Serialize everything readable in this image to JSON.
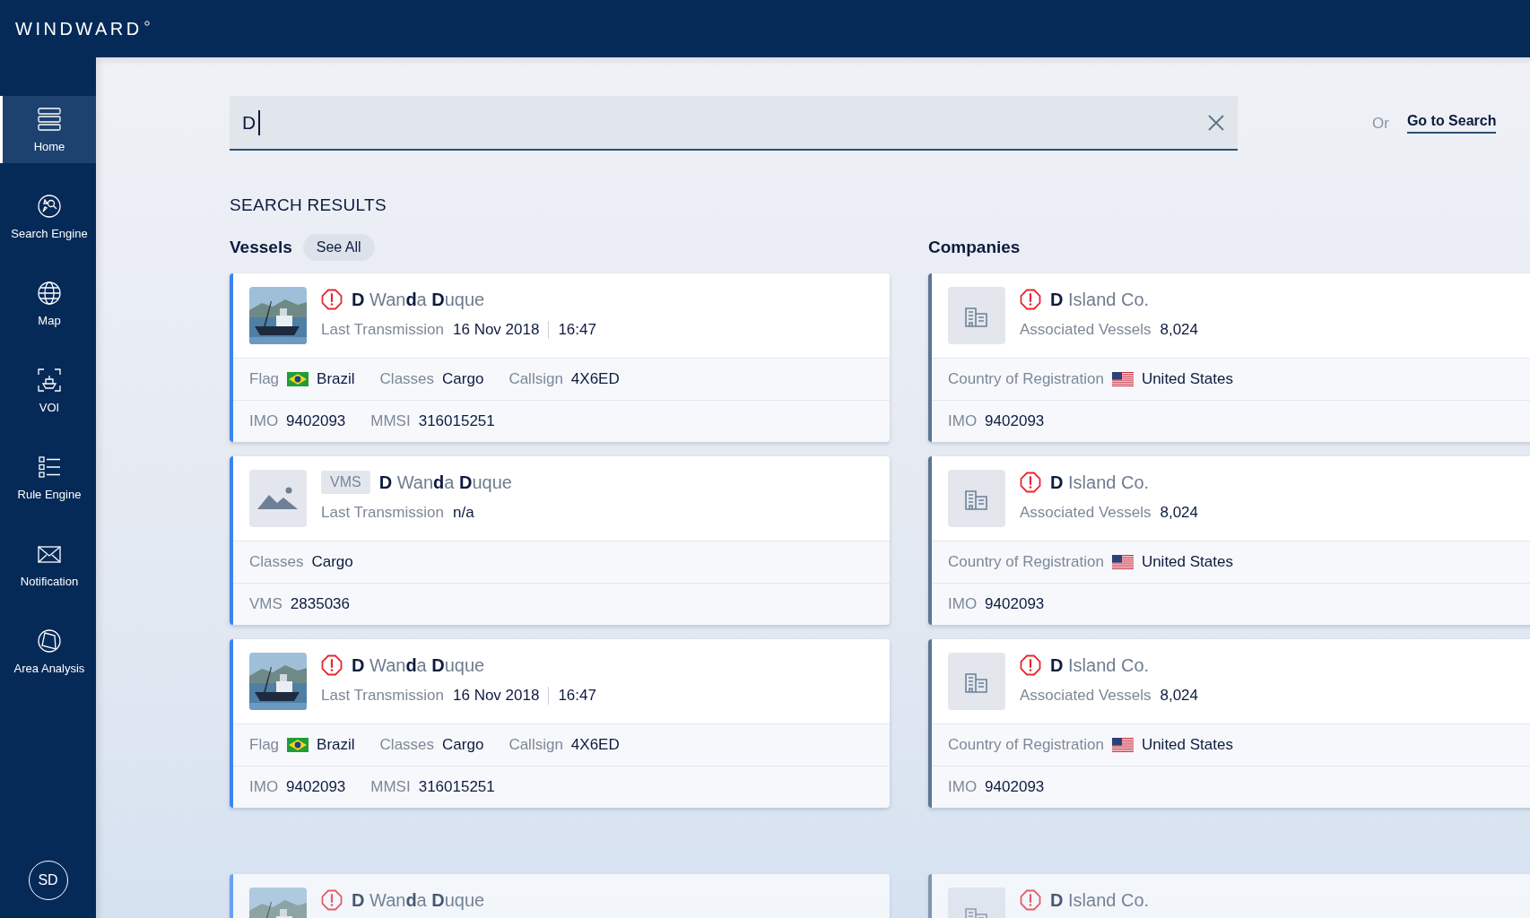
{
  "brand": {
    "name": "WINDWARD"
  },
  "sidebar": {
    "items": [
      {
        "label": "Home",
        "selected": true
      },
      {
        "label": "Search Engine",
        "selected": false
      },
      {
        "label": "Map",
        "selected": false
      },
      {
        "label": "VOI",
        "selected": false
      },
      {
        "label": "Rule Engine",
        "selected": false
      },
      {
        "label": "Notification",
        "selected": false
      },
      {
        "label": "Area Analysis",
        "selected": false
      }
    ],
    "avatar": "SD"
  },
  "search": {
    "value": "D",
    "alternative": {
      "prefix": "Or",
      "link": "Go to Search"
    }
  },
  "results": {
    "title": "SEARCH RESULTS",
    "vessels": {
      "title": "Vessels",
      "see_all": "See All",
      "cards": [
        {
          "alert": true,
          "faded": false,
          "name": "**D** Wan**d**a **D**uque",
          "transmission": {
            "label": "Last Transmission",
            "values": [
              "16 Nov 2018",
              "16:47"
            ]
          },
          "rows": [
            [
              {
                "label": "Flag",
                "value": "Brazil",
                "kind": "brazil"
              },
              {
                "label": "Classes",
                "value": "Cargo"
              },
              {
                "label": "Callsign",
                "value": "4X6ED"
              }
            ],
            [
              {
                "label": "IMO",
                "value": "9402093"
              },
              {
                "label": "MMSI",
                "value": "316015251"
              }
            ]
          ]
        },
        {
          "kind": "placeholder",
          "alert": false,
          "faded": false,
          "badge": "VMS",
          "name": "**D** Wan**d**a **D**uque",
          "transmission": {
            "label": "Last Transmission",
            "values": [
              "n/a"
            ]
          },
          "rows": [
            [
              {
                "label": "Classes",
                "value": "Cargo"
              }
            ],
            [
              {
                "label": "VMS",
                "value": "2835036"
              }
            ]
          ]
        },
        {
          "alert": true,
          "faded": false,
          "name": "**D** Wan**d**a **D**uque",
          "transmission": {
            "label": "Last Transmission",
            "values": [
              "16 Nov 2018",
              "16:47"
            ]
          },
          "rows": [
            [
              {
                "label": "Flag",
                "value": "Brazil",
                "kind": "brazil"
              },
              {
                "label": "Classes",
                "value": "Cargo"
              },
              {
                "label": "Callsign",
                "value": "4X6ED"
              }
            ],
            [
              {
                "label": "IMO",
                "value": "9402093"
              },
              {
                "label": "MMSI",
                "value": "316015251"
              }
            ]
          ]
        },
        {
          "alert": true,
          "faded": true,
          "name": "**D** Wan**d**a **D**uque"
        }
      ]
    },
    "companies": {
      "title": "Companies",
      "cards": [
        {
          "alert": true,
          "faded": false,
          "name": "**D** Island Co.",
          "stat": {
            "label": "Associated Vessels",
            "value": "8,024"
          },
          "rows": [
            [
              {
                "label": "Country of Registration",
                "value": "United States",
                "kind": "usa"
              }
            ],
            [
              {
                "label": "IMO",
                "value": "9402093"
              }
            ]
          ]
        },
        {
          "alert": true,
          "faded": false,
          "name": "**D** Island Co.",
          "stat": {
            "label": "Associated Vessels",
            "value": "8,024"
          },
          "rows": [
            [
              {
                "label": "Country of Registration",
                "value": "United States",
                "kind": "usa"
              }
            ],
            [
              {
                "label": "IMO",
                "value": "9402093"
              }
            ]
          ]
        },
        {
          "alert": true,
          "faded": false,
          "name": "**D** Island Co.",
          "stat": {
            "label": "Associated Vessels",
            "value": "8,024"
          },
          "rows": [
            [
              {
                "label": "Country of Registration",
                "value": "United States",
                "kind": "usa"
              }
            ],
            [
              {
                "label": "IMO",
                "value": "9402093"
              }
            ]
          ]
        },
        {
          "alert": true,
          "faded": true,
          "name": "**D** Island Co."
        }
      ]
    }
  }
}
